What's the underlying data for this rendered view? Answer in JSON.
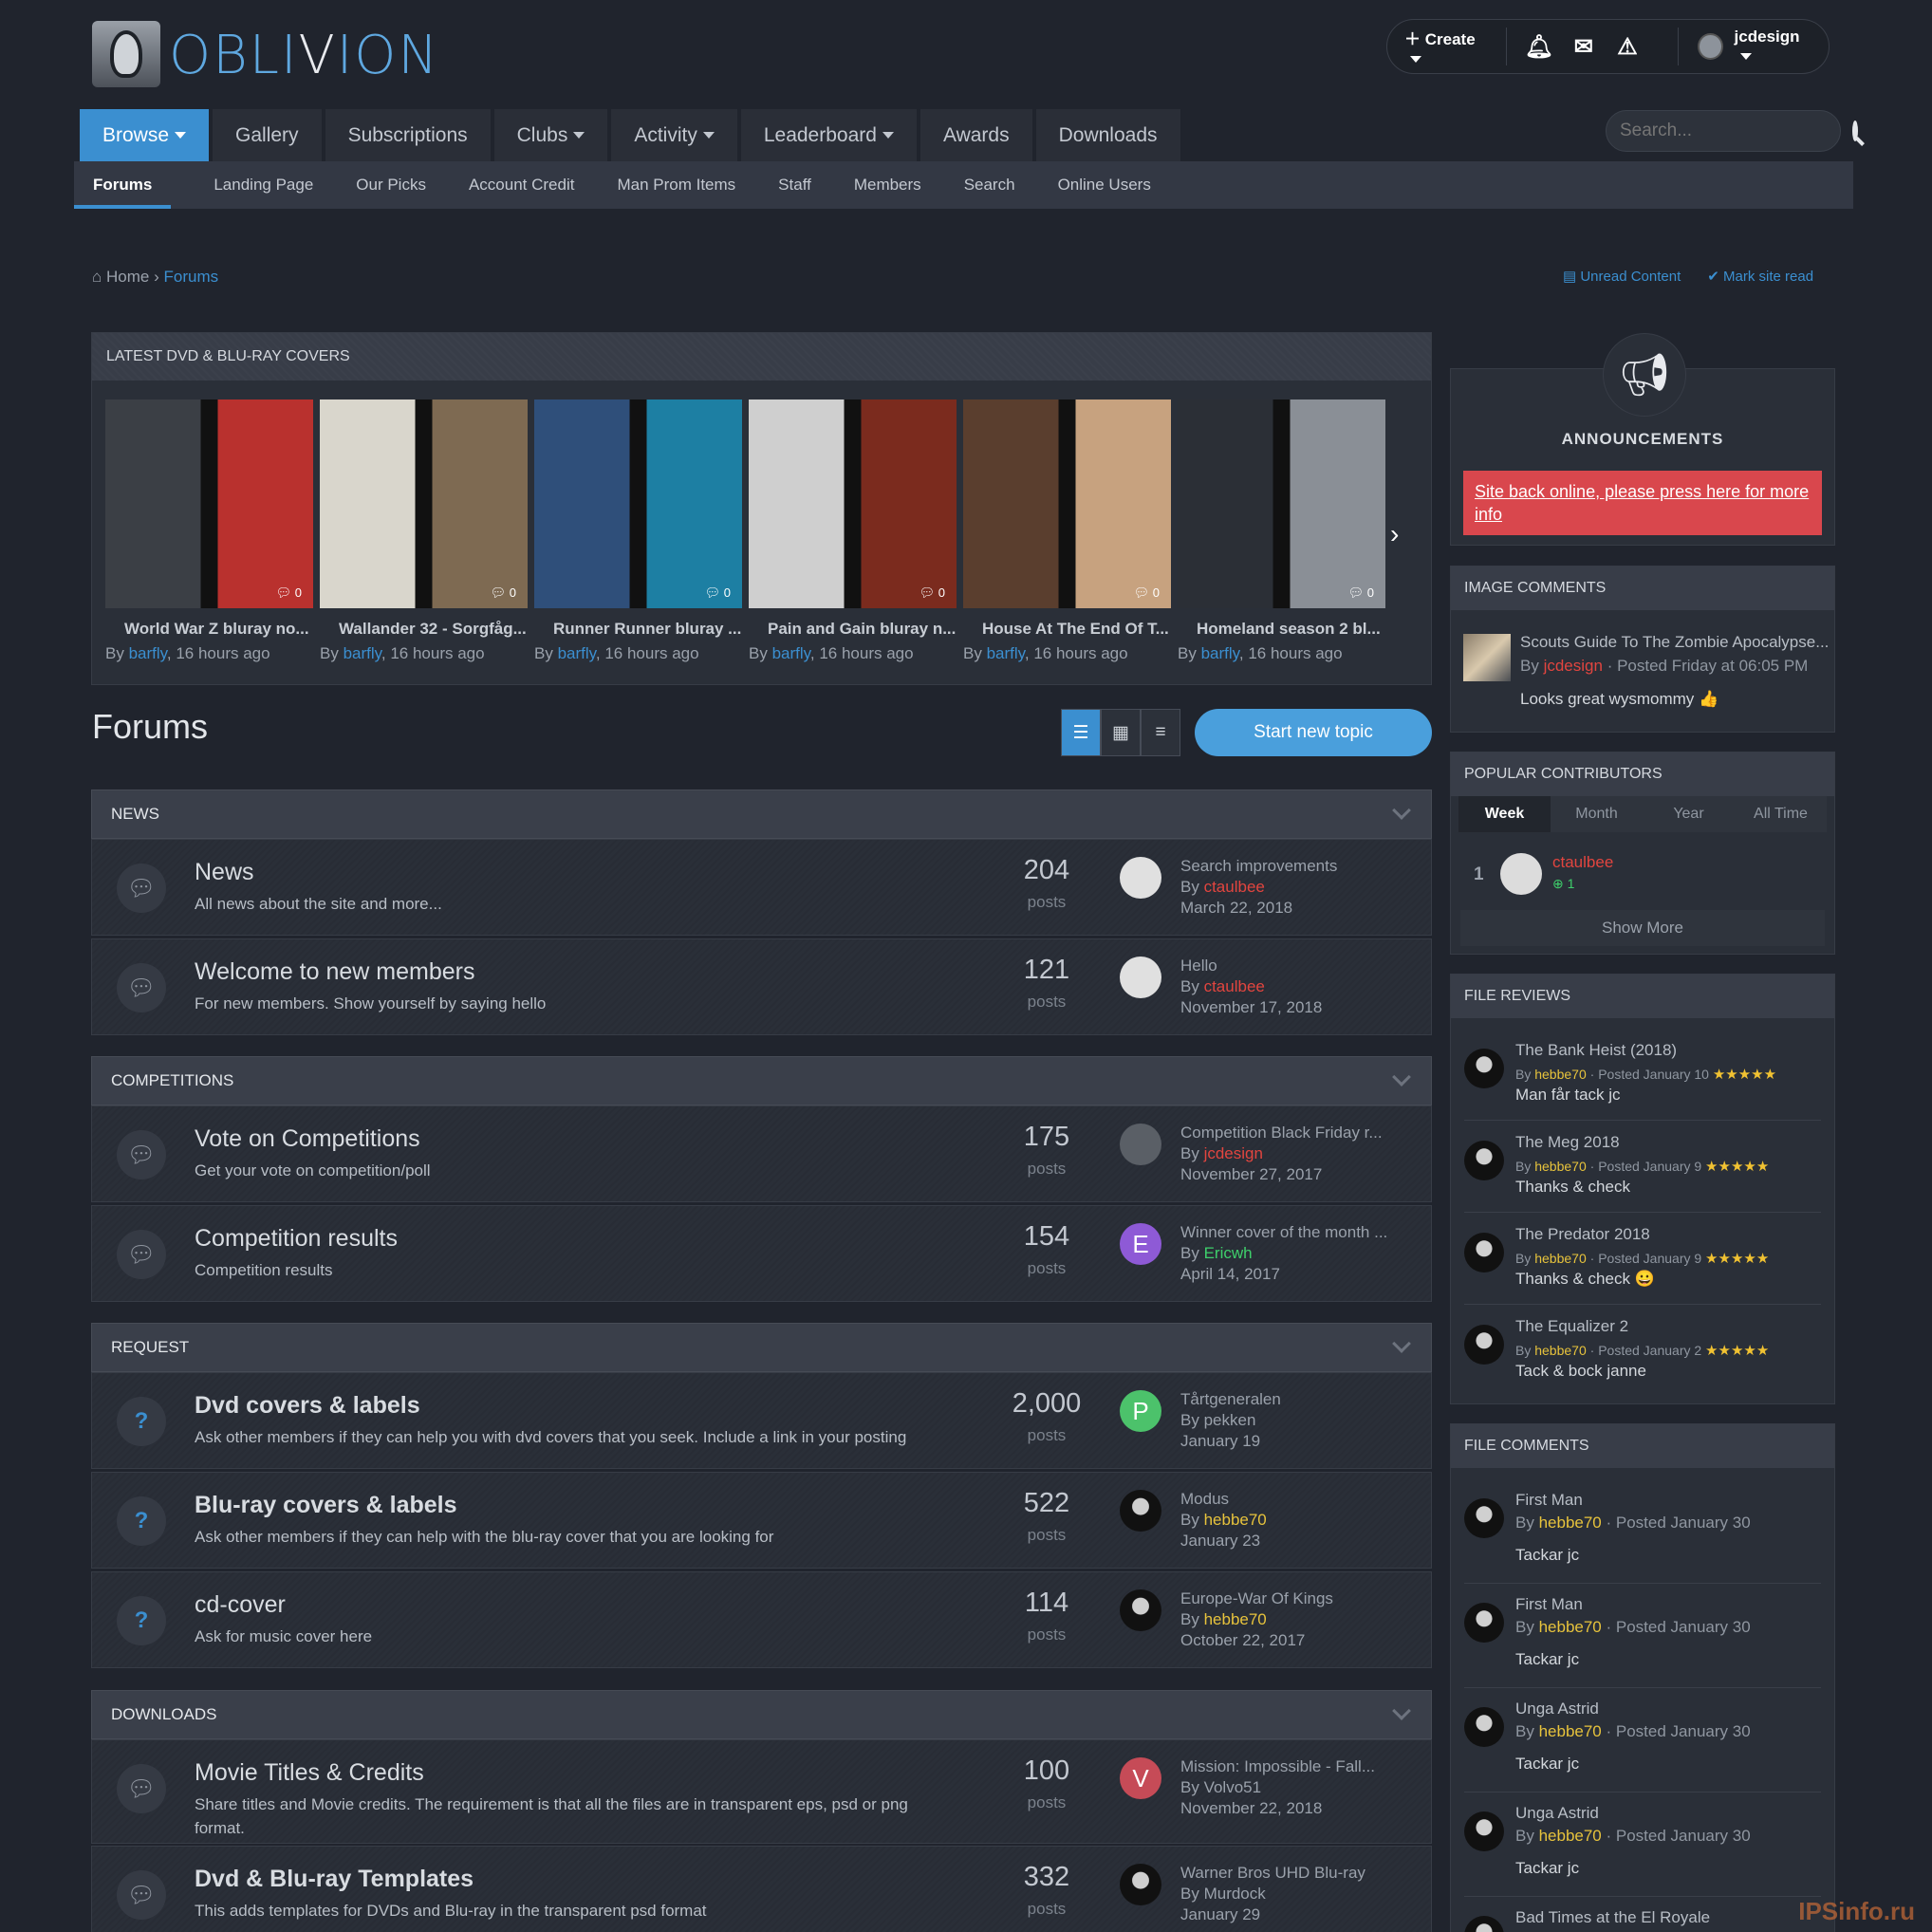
{
  "brand": {
    "logo_text_a": "OBLI",
    "logo_text_b": "V",
    "logo_text_c": "ION"
  },
  "userbar": {
    "create": "Create",
    "username": "jcdesign",
    "icons": [
      "bell-icon",
      "envelope-icon",
      "warning-icon"
    ]
  },
  "nav": [
    {
      "label": "Browse",
      "caret": true,
      "active": true
    },
    {
      "label": "Gallery"
    },
    {
      "label": "Subscriptions"
    },
    {
      "label": "Clubs",
      "caret": true
    },
    {
      "label": "Activity",
      "caret": true
    },
    {
      "label": "Leaderboard",
      "caret": true
    },
    {
      "label": "Awards"
    },
    {
      "label": "Downloads"
    }
  ],
  "search": {
    "placeholder": "Search..."
  },
  "subnav": [
    "Forums",
    "Landing Page",
    "Our Picks",
    "Account Credit",
    "Man Prom Items",
    "Staff",
    "Members",
    "Search",
    "Online Users"
  ],
  "breadcrumb": {
    "home": "Home",
    "current": "Forums",
    "unread": "Unread Content",
    "mark_read": "Mark site read"
  },
  "covers": {
    "title": "LATEST DVD & BLU-RAY COVERS",
    "items": [
      {
        "title": "World War Z bluray no...",
        "by": "By",
        "author": "barfly",
        "time": ", 16 hours ago",
        "count": "0"
      },
      {
        "title": "Wallander 32 - Sorgfåg...",
        "by": "By",
        "author": "barfly",
        "time": ", 16 hours ago",
        "count": "0"
      },
      {
        "title": "Runner Runner bluray ...",
        "by": "By",
        "author": "barfly",
        "time": ", 16 hours ago",
        "count": "0"
      },
      {
        "title": "Pain and Gain bluray n...",
        "by": "By",
        "author": "barfly",
        "time": ", 16 hours ago",
        "count": "0"
      },
      {
        "title": "House At The End Of T...",
        "by": "By",
        "author": "barfly",
        "time": ", 16 hours ago",
        "count": "0"
      },
      {
        "title": "Homeland season 2 bl...",
        "by": "By",
        "author": "barfly",
        "time": ", 16 hours ago",
        "count": "0"
      }
    ]
  },
  "forums": {
    "heading": "Forums",
    "start_topic": "Start new topic"
  },
  "categories": [
    {
      "name": "NEWS",
      "rows": [
        {
          "title": "News",
          "desc": "All news about the site and more...",
          "count": "204",
          "unit": "posts",
          "last_title": "Search improvements",
          "by": "By",
          "last_author": "ctaulbee",
          "last_date": "March 22, 2018"
        },
        {
          "title": "Welcome to new members",
          "desc": "For new members. Show yourself by saying hello",
          "count": "121",
          "unit": "posts",
          "last_title": "Hello",
          "by": "By",
          "last_author": "ctaulbee",
          "last_date": "November 17, 2018"
        }
      ]
    },
    {
      "name": "COMPETITIONS",
      "rows": [
        {
          "title": "Vote on Competitions",
          "desc": "Get your vote on competition/poll",
          "count": "175",
          "unit": "posts",
          "last_title": "Competition Black Friday r...",
          "by": "By",
          "last_author": "jcdesign",
          "last_date": "November 27, 2017"
        },
        {
          "title": "Competition results",
          "desc": "Competition results",
          "count": "154",
          "unit": "posts",
          "last_title": "Winner cover of the month ...",
          "by": "By",
          "last_author": "Ericwh",
          "last_date": "April 14, 2017",
          "avatar_letter": "E"
        }
      ]
    },
    {
      "name": "REQUEST",
      "rows": [
        {
          "title": "Dvd covers & labels",
          "desc": "Ask other members if they can help you with dvd covers that you seek. Include a link in your posting",
          "count": "2,000",
          "unit": "posts",
          "last_title": "Tårtgeneralen",
          "by": "By",
          "last_author": "pekken",
          "last_date": "January 19",
          "avatar_letter": "P"
        },
        {
          "title": "Blu-ray covers & labels",
          "desc": "Ask other members if they can help with the blu-ray cover that you are looking for",
          "count": "522",
          "unit": "posts",
          "last_title": "Modus",
          "by": "By",
          "last_author": "hebbe70",
          "last_date": "January 23"
        },
        {
          "title": "cd-cover",
          "desc": "Ask for music cover here",
          "count": "114",
          "unit": "posts",
          "last_title": "Europe-War Of Kings",
          "by": "By",
          "last_author": "hebbe70",
          "last_date": "October 22, 2017"
        }
      ]
    },
    {
      "name": "DOWNLOADS",
      "rows": [
        {
          "title": "Movie Titles & Credits",
          "desc": "Share titles and Movie credits. The requirement is that all the files are in transparent eps, psd or png format.",
          "count": "100",
          "unit": "posts",
          "last_title": "Mission: Impossible - Fall...",
          "by": "By",
          "last_author": "Volvo51",
          "last_date": "November 22, 2018",
          "avatar_letter": "V"
        },
        {
          "title": "Dvd & Blu-ray Templates",
          "desc": "This adds templates for DVDs and Blu-ray in the transparent psd format",
          "count": "332",
          "unit": "posts",
          "last_title": "Warner Bros UHD Blu-ray",
          "by": "By",
          "last_author": "Murdock",
          "last_date": "January 29"
        }
      ]
    }
  ],
  "sidebar": {
    "announcements": {
      "title": "ANNOUNCEMENTS",
      "text": "Site back online, please press here for more info"
    },
    "image_comments": {
      "title": "IMAGE COMMENTS",
      "item_title": "Scouts Guide To The Zombie Apocalypse...",
      "by": "By",
      "author": "jcdesign",
      "posted": "· Posted Friday at 06:05 PM",
      "comment": "Looks great wysmommy 👍"
    },
    "contributors": {
      "title": "POPULAR CONTRIBUTORS",
      "tabs": [
        "Week",
        "Month",
        "Year",
        "All Time"
      ],
      "rank": "1",
      "name": "ctaulbee",
      "points": "1",
      "show_more": "Show More"
    },
    "file_reviews": {
      "title": "FILE REVIEWS",
      "items": [
        {
          "title": "The Bank Heist (2018)",
          "by": "By",
          "author": "hebbe70",
          "posted": "· Posted January 10",
          "stars": "★★★★★",
          "text": "Man får tack jc"
        },
        {
          "title": "The Meg 2018",
          "by": "By",
          "author": "hebbe70",
          "posted": "· Posted January 9",
          "stars": "★★★★★",
          "text": "Thanks & check"
        },
        {
          "title": "The Predator 2018",
          "by": "By",
          "author": "hebbe70",
          "posted": "· Posted January 9",
          "stars": "★★★★★",
          "text": "Thanks & check 😀"
        },
        {
          "title": "The Equalizer 2",
          "by": "By",
          "author": "hebbe70",
          "posted": "· Posted January 2",
          "stars": "★★★★★",
          "text": "Tack & bock janne"
        }
      ]
    },
    "file_comments": {
      "title": "FILE COMMENTS",
      "items": [
        {
          "title": "First Man",
          "by": "By",
          "author": "hebbe70",
          "posted": "· Posted January 30",
          "text": "Tackar jc"
        },
        {
          "title": "First Man",
          "by": "By",
          "author": "hebbe70",
          "posted": "· Posted January 30",
          "text": "Tackar jc"
        },
        {
          "title": "Unga Astrid",
          "by": "By",
          "author": "hebbe70",
          "posted": "· Posted January 30",
          "text": "Tackar jc"
        },
        {
          "title": "Unga Astrid",
          "by": "By",
          "author": "hebbe70",
          "posted": "· Posted January 30",
          "text": "Tackar jc"
        },
        {
          "title": "Bad Times at the El Royale"
        }
      ]
    }
  },
  "watermark": "IPSinfo.ru"
}
